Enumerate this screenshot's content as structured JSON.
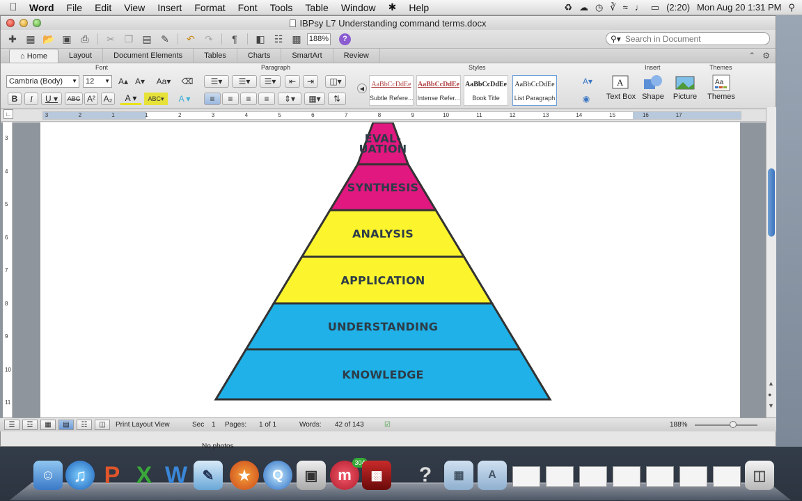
{
  "menubar": {
    "app_name": "Word",
    "items": [
      "File",
      "Edit",
      "View",
      "Insert",
      "Format",
      "Font",
      "Tools",
      "Table",
      "Window",
      "Help"
    ],
    "battery": "(2:20)",
    "clock": "Mon Aug 20  1:31 PM"
  },
  "window": {
    "title": "IBPsy L7 Understanding command terms.docx"
  },
  "toolbar": {
    "zoom": "188%",
    "help": "?",
    "search_placeholder": "Search in Document"
  },
  "ribbon_tabs": [
    "Home",
    "Layout",
    "Document Elements",
    "Tables",
    "Charts",
    "SmartArt",
    "Review"
  ],
  "ribbon": {
    "group_font": "Font",
    "group_paragraph": "Paragraph",
    "group_styles": "Styles",
    "group_insert": "Insert",
    "group_themes": "Themes",
    "font_name": "Cambria (Body)",
    "font_size": "12",
    "styles": [
      {
        "sample": "AaBbCcDdEe",
        "name": "Subtle Refere..."
      },
      {
        "sample": "AaBbCcDdEe",
        "name": "Intense Refer..."
      },
      {
        "sample": "AaBbCcDdEe",
        "name": "Book Title"
      },
      {
        "sample": "AaBbCcDdEe",
        "name": "List Paragraph"
      }
    ],
    "insert_buttons": [
      "Text Box",
      "Shape",
      "Picture"
    ],
    "themes_button": "Themes"
  },
  "ruler": {
    "numbers": [
      "3",
      "2",
      "1",
      "1",
      "2",
      "3",
      "4",
      "5",
      "6",
      "7",
      "8",
      "9",
      "10",
      "11",
      "12",
      "13",
      "14",
      "15",
      "16",
      "17"
    ]
  },
  "vruler": {
    "numbers": [
      "3",
      "4",
      "5",
      "6",
      "7",
      "8",
      "9",
      "10",
      "11"
    ]
  },
  "pyramid": {
    "levels": [
      {
        "label": "EVAL-\nUATION",
        "color": "#e0187f"
      },
      {
        "label": "SYNTHESIS",
        "color": "#e0187f"
      },
      {
        "label": "ANALYSIS",
        "color": "#fcf52e"
      },
      {
        "label": "APPLICATION",
        "color": "#fcf52e"
      },
      {
        "label": "UNDERSTANDING",
        "color": "#1fb1e8"
      },
      {
        "label": "KNOWLEDGE",
        "color": "#1fb1e8"
      }
    ],
    "label_color": "#2d3c48",
    "outline_color": "#333333"
  },
  "statusbar": {
    "view": "Print Layout View",
    "sec_label": "Sec",
    "sec_value": "1",
    "pages_label": "Pages:",
    "pages_value": "1 of 1",
    "words_label": "Words:",
    "words_value": "42 of 143",
    "zoom": "188%"
  },
  "dock": {
    "no_photos": "No photos",
    "badge": "304"
  }
}
